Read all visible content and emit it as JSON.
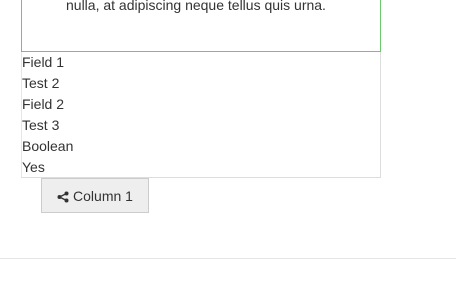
{
  "panel": {
    "text": "nulla, at adipiscing neque tellus quis urna."
  },
  "fields": [
    {
      "label": "Field 1"
    },
    {
      "label": "Test 2"
    },
    {
      "label": "Field 2"
    },
    {
      "label": "Test 3"
    },
    {
      "label": "Boolean"
    },
    {
      "label": "Yes"
    }
  ],
  "column_button": {
    "label": "Column 1",
    "icon": "share-icon"
  }
}
